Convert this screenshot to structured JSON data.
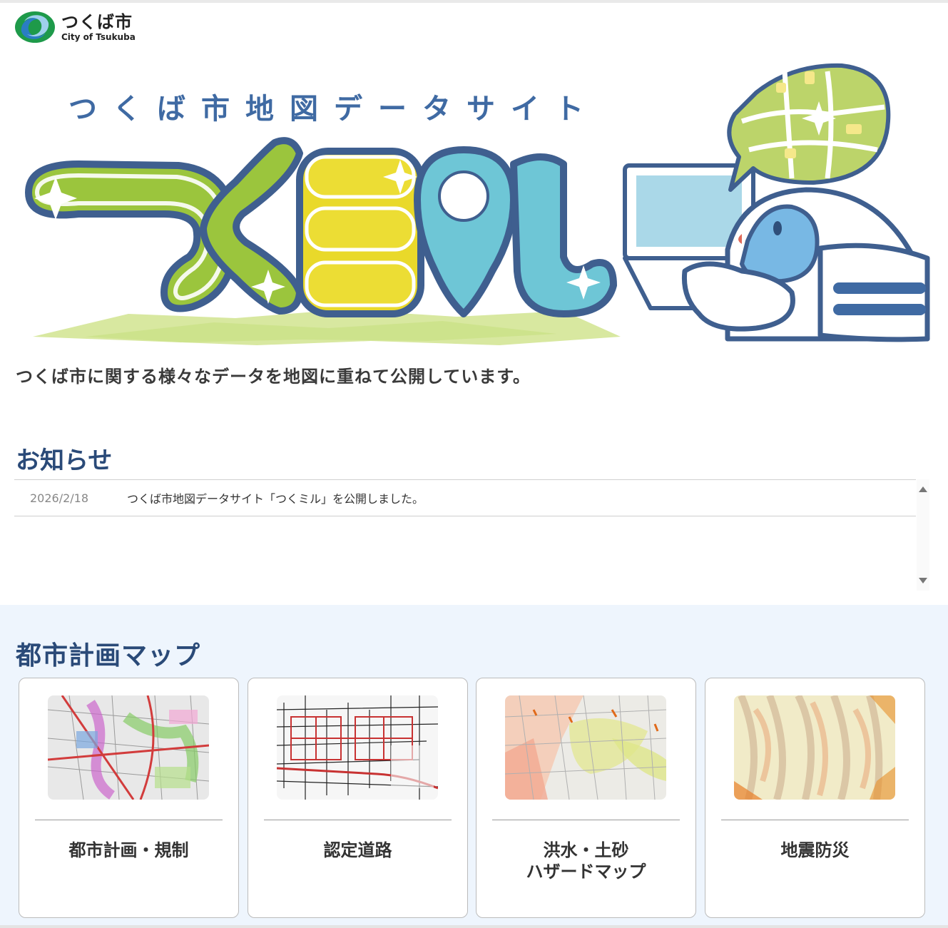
{
  "header": {
    "logo_jp": "つくば市",
    "logo_en": "City of Tsukuba"
  },
  "hero": {
    "subtitle": "つくば市地図データサイト",
    "title": "つくミル"
  },
  "intro": "つくば市に関する様々なデータを地図に重ねて公開しています。",
  "news": {
    "title": "お知らせ",
    "items": [
      {
        "date": "2026/2/18",
        "text": "つくば市地図データサイト「つくミル」を公開しました。"
      }
    ]
  },
  "maps": {
    "title": "都市計画マップ",
    "cards": [
      {
        "label": "都市計画・規制",
        "thumb": "city-planning-map"
      },
      {
        "label": "認定道路",
        "thumb": "certified-roads-map"
      },
      {
        "label": "洪水・土砂\nハザードマップ",
        "thumb": "flood-hazard-map"
      },
      {
        "label": "地震防災",
        "thumb": "earthquake-map"
      }
    ]
  },
  "colors": {
    "heading": "#2a4a78",
    "green": "#9bc53d",
    "yellow": "#e9d92a",
    "cyan": "#6ec6d6",
    "outline": "#3f5f8f",
    "section_bg": "#eef5fd"
  }
}
